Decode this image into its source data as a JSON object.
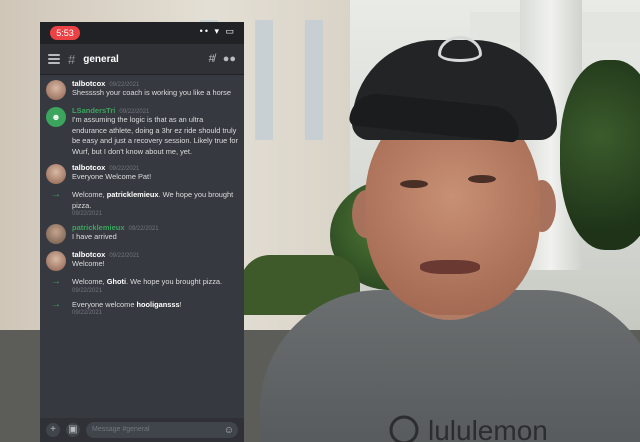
{
  "status": {
    "time": "5:53",
    "icons": "•• ▾ ▭"
  },
  "channel": {
    "hash": "#",
    "name": "general"
  },
  "messages": [
    {
      "author": "talbotcox",
      "date": "09/22/2021",
      "text": "Shessssh your coach is working you like a horse"
    },
    {
      "author": "LSandersTri",
      "date": "09/22/2021",
      "text": "I'm assuming the logic is that as an ultra endurance athlete, doing a 3hr ez ride should truly be easy and just a recovery session. Likely true for Wurf, but I don't know about me, yet."
    },
    {
      "author": "talbotcox",
      "date": "09/22/2021",
      "text": "Everyone Welcome Pat!"
    },
    {
      "author": "patricklemieux",
      "date": "09/22/2021",
      "text": "I have arrived"
    },
    {
      "author": "talbotcox",
      "date": "09/22/2021",
      "text": "Welcome!"
    }
  ],
  "joins": [
    {
      "pre": "Welcome, ",
      "user": "patricklemieux",
      "post": ". We hope you brought pizza.",
      "date": "09/22/2021"
    },
    {
      "pre": "Welcome, ",
      "user": "Ghoti",
      "post": ". We hope you brought pizza.",
      "date": "09/22/2021"
    },
    {
      "pre": "Everyone welcome ",
      "user": "hooligansss",
      "post": "!",
      "date": "09/22/2021"
    }
  ],
  "composer": {
    "placeholder": "Message #general"
  },
  "colors": {
    "discord_bg": "#36393f",
    "accent_green": "#3ba55d",
    "status_red": "#ed4245"
  },
  "icons": [
    "menu-icon",
    "threads-icon",
    "members-icon",
    "plus-icon",
    "gift-icon",
    "emoji-icon",
    "arrow-icon",
    "discord-icon"
  ],
  "shirt_text": "lululemon"
}
